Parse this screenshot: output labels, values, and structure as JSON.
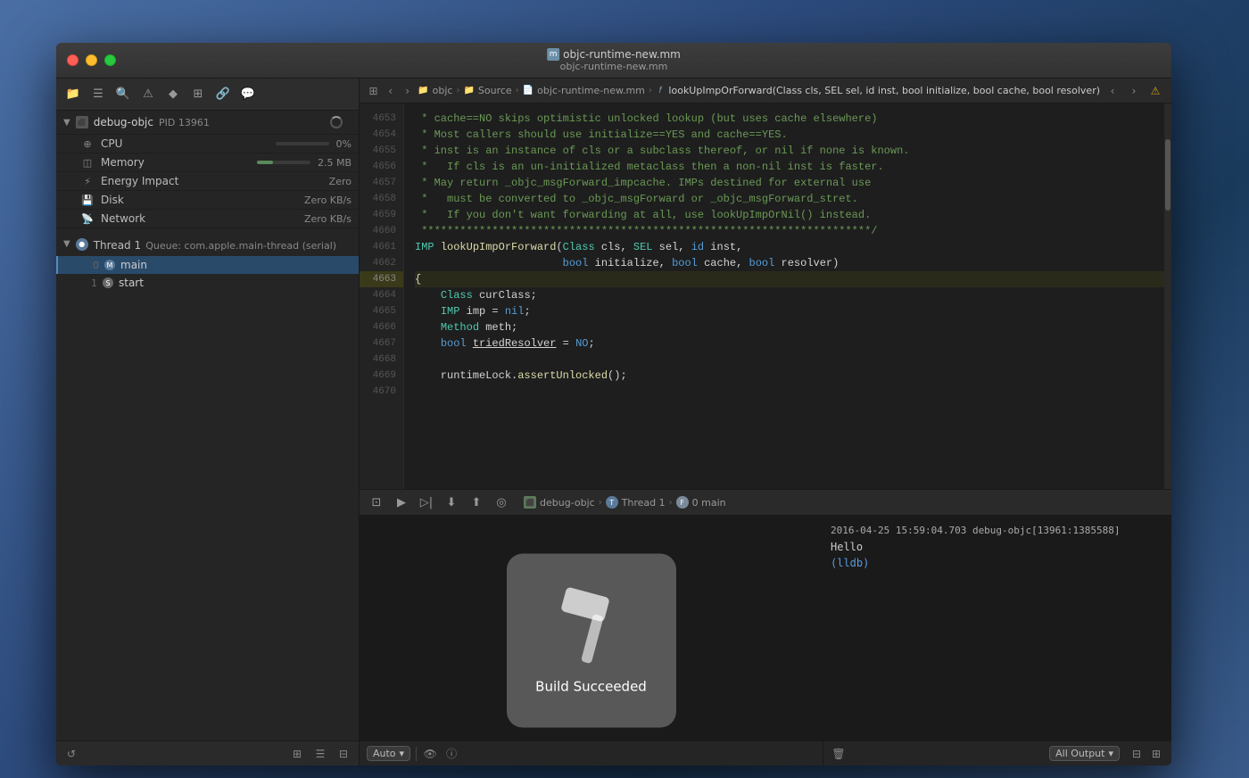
{
  "window": {
    "title_main": "objc-runtime-new.mm",
    "title_sub": "objc-runtime-new.mm",
    "title_icon": "m"
  },
  "sidebar": {
    "process_name": "debug-objc",
    "process_pid": "PID 13961",
    "cpu_label": "CPU",
    "cpu_value": "0%",
    "memory_label": "Memory",
    "memory_value": "2.5 MB",
    "energy_label": "Energy Impact",
    "energy_value": "Zero",
    "disk_label": "Disk",
    "disk_value": "Zero KB/s",
    "network_label": "Network",
    "network_value": "Zero KB/s",
    "thread_label": "Thread 1",
    "thread_queue": "Queue: com.apple.main-thread (serial)",
    "frame0_num": "0",
    "frame0_name": "main",
    "frame1_num": "1",
    "frame1_name": "start"
  },
  "breadcrumb": {
    "back": "<",
    "forward": ">",
    "item1": "objc",
    "item2": "Source",
    "item3": "objc-runtime-new.mm",
    "item4": "lookUpImpOrForward(Class cls, SEL sel, id inst, bool initialize, bool cache, bool resolver)"
  },
  "code_lines": [
    {
      "num": "4653",
      "text": " * cache==NO skips optimistic unlocked lookup (but uses cache elsewhere)",
      "class": "c-comment"
    },
    {
      "num": "4654",
      "text": " * Most callers should use initialize==YES and cache==YES.",
      "class": "c-comment"
    },
    {
      "num": "4655",
      "text": " * inst is an instance of cls or a subclass thereof, or nil if none is known.",
      "class": "c-comment"
    },
    {
      "num": "4656",
      "text": " *   If cls is an un-initialized metaclass then a non-nil inst is faster.",
      "class": "c-comment"
    },
    {
      "num": "4657",
      "text": " * May return _objc_msgForward_impcache. IMPs destined for external use",
      "class": "c-comment"
    },
    {
      "num": "4658",
      "text": " *   must be converted to _objc_msgForward or _objc_msgForward_stret.",
      "class": "c-comment"
    },
    {
      "num": "4659",
      "text": " *   If you don't want forwarding at all, use lookUpImpOrNil() instead.",
      "class": "c-comment"
    },
    {
      "num": "4660",
      "text": " **********************************************************************/",
      "class": "c-comment"
    },
    {
      "num": "4661",
      "text": "IMP lookUpImpOrForward(Class cls, SEL sel, id inst,",
      "class": "c-normal"
    },
    {
      "num": "4662",
      "text": "                       bool initialize, bool cache, bool resolver)",
      "class": "c-normal"
    },
    {
      "num": "4663",
      "text": "{",
      "class": "c-normal"
    },
    {
      "num": "4664",
      "text": "    Class curClass;",
      "class": "c-normal"
    },
    {
      "num": "4665",
      "text": "    IMP imp = nil;",
      "class": "c-normal"
    },
    {
      "num": "4666",
      "text": "    Method meth;",
      "class": "c-normal"
    },
    {
      "num": "4667",
      "text": "    bool triedResolver = NO;",
      "class": "c-normal"
    },
    {
      "num": "4668",
      "text": "",
      "class": "c-normal"
    },
    {
      "num": "4669",
      "text": "    runtimeLock.assertUnlocked();",
      "class": "c-normal"
    },
    {
      "num": "4670",
      "text": "",
      "class": "c-normal"
    }
  ],
  "debug_toolbar": {
    "project": "debug-objc",
    "thread": "Thread 1",
    "frame": "0 main"
  },
  "build_overlay": {
    "text": "Build Succeeded"
  },
  "debug_console": {
    "line1": "2016-04-25 15:59:04.703 debug-objc[13961:1385588]",
    "line2": "Hello",
    "line3": "(lldb)"
  },
  "console_bottom": {
    "auto_label": "Auto",
    "output_label": "All Output"
  }
}
